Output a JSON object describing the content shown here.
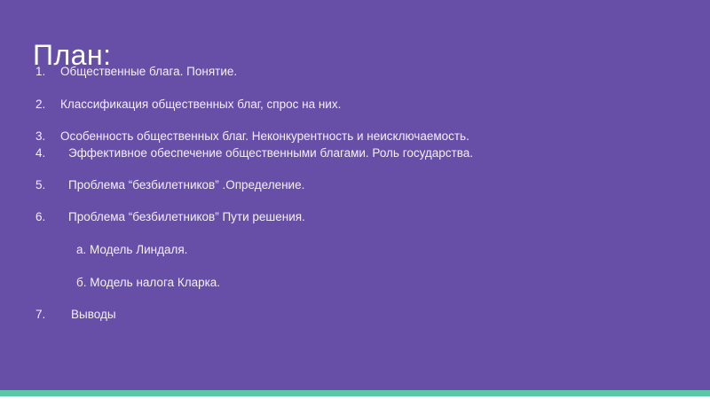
{
  "slide": {
    "title": "План:",
    "items": [
      {
        "num": "1.",
        "text": "Общественные блага. Понятие."
      },
      {
        "num": "2.",
        "text": "Классификация общественных благ, спрос на них."
      },
      {
        "num": "3.",
        "text": "Особенность общественных благ. Неконкурентность и неисключаемость."
      },
      {
        "num": "4.",
        "text": "Эффективное обеспечение общественными благами. Роль государства."
      },
      {
        "num": "5.",
        "text": "Проблема “безбилетников” .Определение."
      },
      {
        "num": "6.",
        "text": "Проблема “безбилетников” Пути решения."
      },
      {
        "num": "",
        "text": "а. Модель Линдаля."
      },
      {
        "num": "",
        "text": "б. Модель налога Кларка."
      },
      {
        "num": "7.",
        "text": "Выводы"
      }
    ]
  },
  "colors": {
    "background": "#674ea7",
    "accent_bar": "#5cc8a8",
    "text": "#f3f0fb"
  }
}
